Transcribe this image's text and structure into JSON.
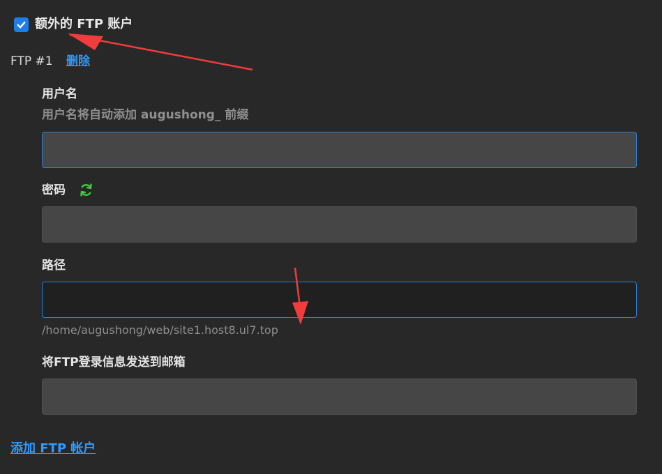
{
  "extra_ftp": {
    "checked": true,
    "label": "额外的 FTP 账户"
  },
  "ftp_entry": {
    "title": "FTP #1",
    "delete_label": "删除"
  },
  "username": {
    "label": "用户名",
    "hint": "用户名将自动添加 augushong_ 前缀",
    "value": ""
  },
  "password": {
    "label": "密码",
    "refresh_icon": "refresh-icon",
    "value": ""
  },
  "path": {
    "label": "路径",
    "value": "",
    "hint": "/home/augushong/web/site1.host8.ul7.top"
  },
  "email": {
    "label": "将FTP登录信息发送到邮箱",
    "value": ""
  },
  "add_ftp_label": "添加 FTP 帐户",
  "colors": {
    "background": "#282828",
    "accent": "#2f9bff",
    "checkbox": "#1e7ee8",
    "refresh_icon": "#3ec93e",
    "annotation_arrow": "#f03c3c"
  }
}
